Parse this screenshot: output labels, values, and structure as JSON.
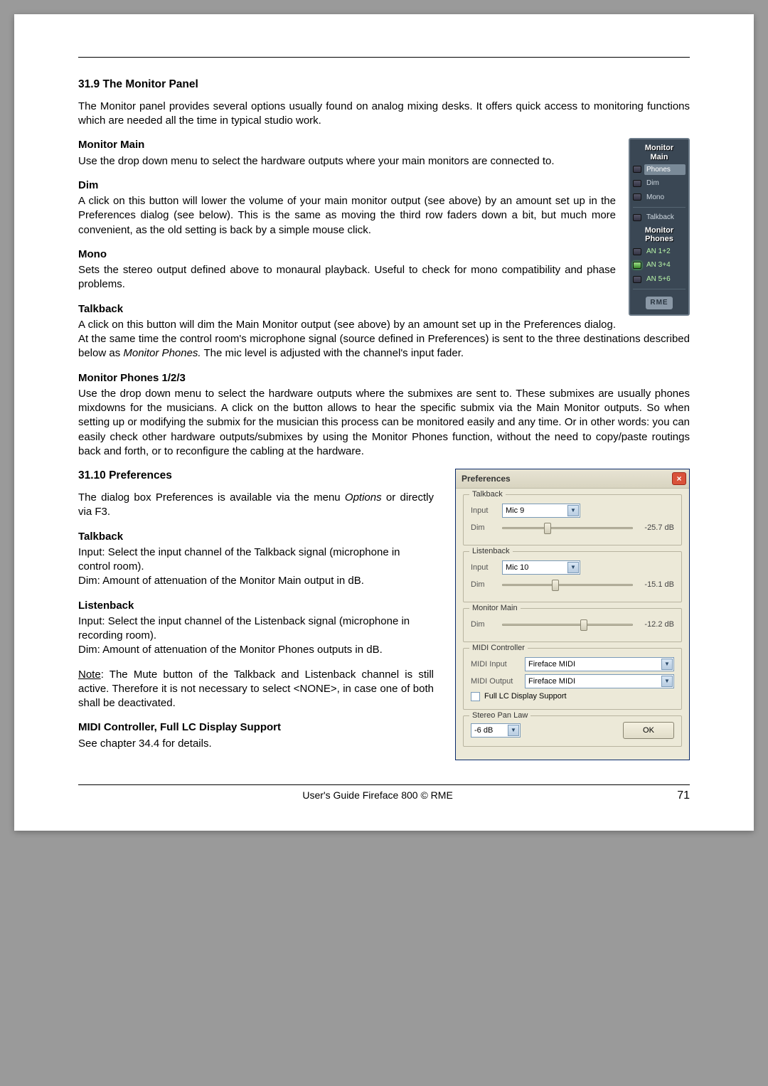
{
  "section1": {
    "title": "31.9 The Monitor Panel",
    "intro": "The Monitor panel provides several options usually found on analog mixing desks. It offers quick access to monitoring functions which are needed all the time in typical studio work.",
    "main_h": "Monitor Main",
    "main_t": "Use the drop down menu to select the hardware outputs where your main monitors are connected to.",
    "dim_h": "Dim",
    "dim_t": "A click on this button will lower the volume of your main monitor output (see above) by an amount set up in the Preferences dialog (see below). This is the same as moving the third row faders down a bit, but much more convenient, as the old setting is back by a simple mouse click.",
    "mono_h": "Mono",
    "mono_t": "Sets the stereo output defined above to monaural playback. Useful to check for mono compatibility and phase problems.",
    "tb_h": "Talkback",
    "tb_t1": "A click on this button will dim the Main Monitor output (see above) by an amount set up in the Preferences dialog. At the same time the control room's microphone signal (source defined in Preferences) is sent to the three destinations described below as ",
    "tb_i": "Monitor Phones.",
    "tb_t2": " The mic level is adjusted with the channel's input fader.",
    "ph_h": "Monitor Phones 1/2/3",
    "ph_t": "Use the drop down menu to select the hardware outputs where the submixes are sent to. These submixes are usually phones mixdowns for the musicians. A click on the button allows to hear the specific submix via the Main Monitor outputs. So when setting up or modifying the submix for the musician this process can be monitored easily and any time. Or in other words: you can easily check other hardware outputs/submixes by using the Monitor Phones function, without the need to copy/paste routings back and forth, or to reconfigure the cabling at the hardware."
  },
  "section2": {
    "title": "31.10 Preferences",
    "intro1": "The dialog box Preferences is available via the menu ",
    "intro_i": "Options",
    "intro2": " or directly via F3.",
    "tb_h": "Talkback",
    "tb_t1": "Input: Select the input channel of the Talkback signal (microphone in control room).",
    "tb_t2": "Dim: Amount of attenuation of the Monitor Main output in dB.",
    "lb_h": "Listenback",
    "lb_t1": "Input: Select the input channel of the Listenback signal (microphone in recording room).",
    "lb_t2": "Dim: Amount of attenuation of the Monitor Phones outputs in dB.",
    "note_u": "Note",
    "note_t": ": The Mute button of the Talkback and Listenback channel is still active. Therefore it is not necessary to select <NONE>, in case one of both shall be deactivated.",
    "midi_h": "MIDI Controller, Full LC Display Support",
    "midi_t": "See chapter 34.4 for details."
  },
  "monitor": {
    "title1": "Monitor",
    "title2": "Main",
    "phones": "Phones",
    "dim": "Dim",
    "mono": "Mono",
    "talkback": "Talkback",
    "ptitle1": "Monitor",
    "ptitle2": "Phones",
    "an12": "AN 1+2",
    "an34": "AN 3+4",
    "an56": "AN 5+6",
    "logo": "RME"
  },
  "prefs": {
    "title": "Preferences",
    "close": "×",
    "talkback": "Talkback",
    "listenback": "Listenback",
    "monmain": "Monitor Main",
    "midictrl": "MIDI Controller",
    "panlaw": "Stereo Pan Law",
    "input": "Input",
    "dim": "Dim",
    "midiin": "MIDI Input",
    "midiout": "MIDI Output",
    "fulllc": "Full LC Display Support",
    "tb_in": "Mic 9",
    "tb_dim": "-25.7 dB",
    "lb_in": "Mic 10",
    "lb_dim": "-15.1 dB",
    "mm_dim": "-12.2 dB",
    "midi_val": "Fireface MIDI",
    "pan_val": "-6 dB",
    "ok": "OK"
  },
  "footer": {
    "center": "User's Guide Fireface 800 © RME",
    "page": "71"
  }
}
